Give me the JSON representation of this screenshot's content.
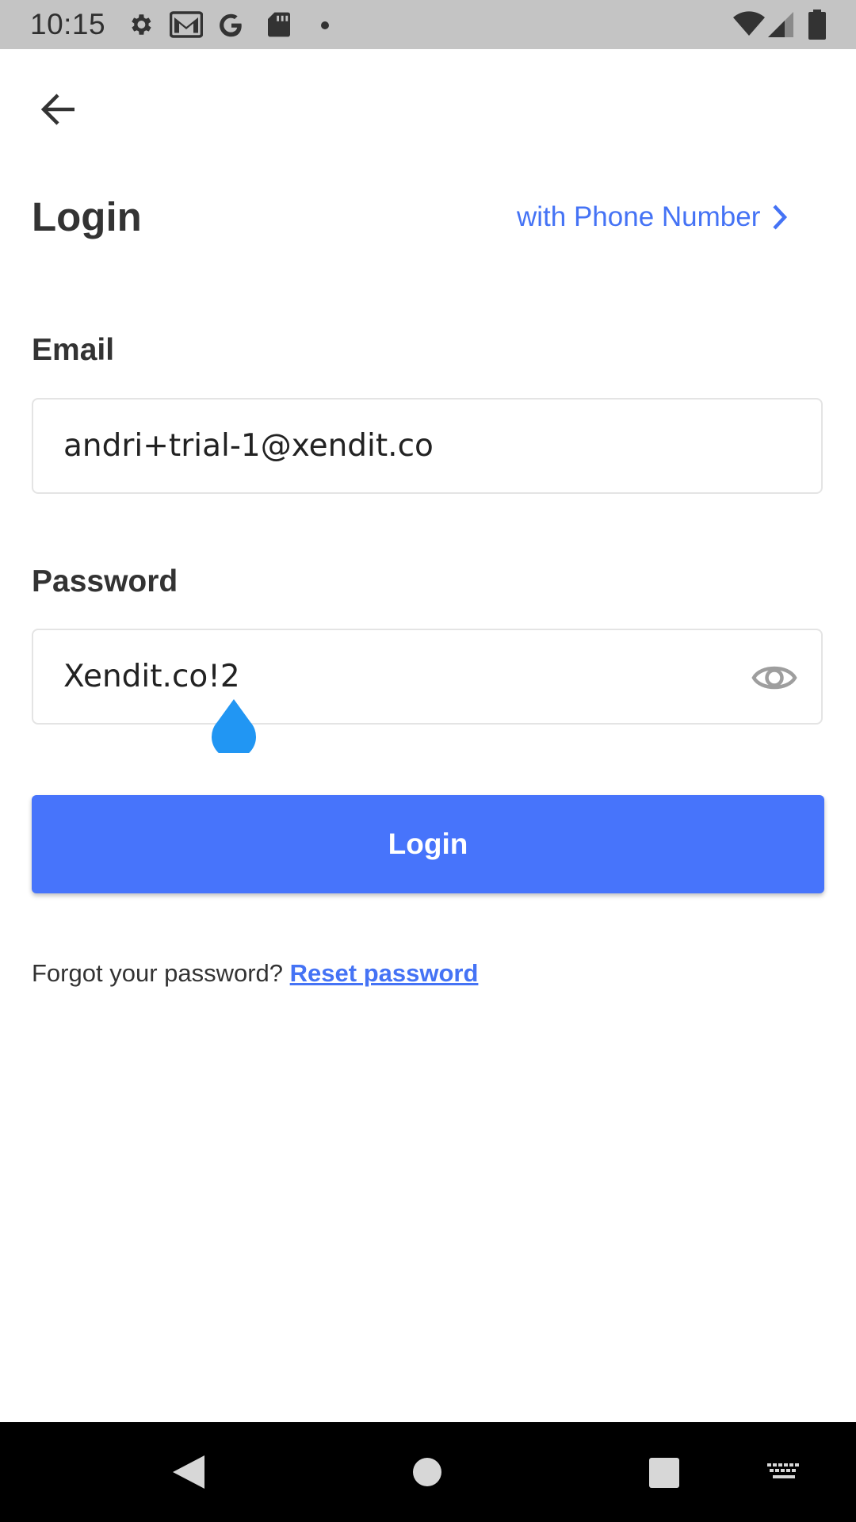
{
  "status_bar": {
    "time": "10:15",
    "left_icons": [
      "settings-icon",
      "gmail-icon",
      "google-icon",
      "sd-card-icon",
      "dot-icon"
    ],
    "right_icons": [
      "wifi-icon",
      "cell-signal-icon",
      "battery-icon"
    ]
  },
  "header": {
    "back_icon": "arrow-left-icon"
  },
  "title": "Login",
  "phone_link": {
    "label": "with Phone Number",
    "icon": "chevron-right-icon"
  },
  "email": {
    "label": "Email",
    "value": "andri+trial-1@xendit.co"
  },
  "password": {
    "label": "Password",
    "value": "Xendit.co!2",
    "toggle_icon": "eye-icon"
  },
  "login_button": {
    "label": "Login"
  },
  "forgot": {
    "text": "Forgot your password? ",
    "link": "Reset password"
  },
  "nav_bar": {
    "icons": [
      "back-triangle-icon",
      "home-circle-icon",
      "recents-square-icon",
      "keyboard-icon"
    ]
  },
  "colors": {
    "accent": "#4774fb",
    "link": "#4573f5",
    "text_cursor_handle": "#2196f3",
    "status_bar_bg": "#c4c4c4",
    "nav_bar_bg": "#000000"
  }
}
